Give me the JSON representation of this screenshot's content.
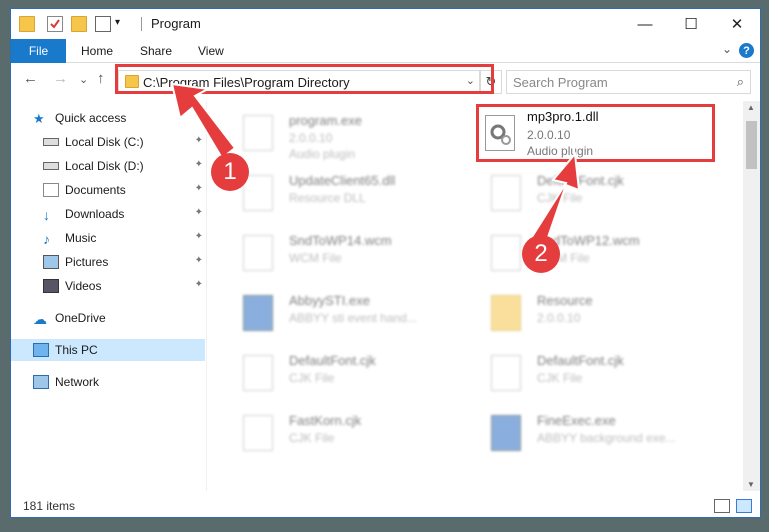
{
  "window": {
    "title": "Program",
    "minimize": "—",
    "maximize": "☐",
    "close": "✕"
  },
  "ribbon": {
    "tabs": [
      "File",
      "Home",
      "Share",
      "View"
    ],
    "help": "?",
    "collapse": "⌄"
  },
  "nav": {
    "back": "←",
    "forward": "→",
    "recent": "⌄",
    "up": "↑",
    "address": "C:\\Program Files\\Program Directory",
    "dropdown": "⌄",
    "refresh": "↻",
    "search_placeholder": "Search Program",
    "search_icon": "⌕"
  },
  "sidebar": {
    "items": [
      {
        "label": "Quick access",
        "icon": "star-icon",
        "pinned": false
      },
      {
        "label": "Local Disk (C:)",
        "icon": "drive-icon",
        "pinned": true
      },
      {
        "label": "Local Disk (D:)",
        "icon": "drive-icon",
        "pinned": true
      },
      {
        "label": "Documents",
        "icon": "documents-icon",
        "pinned": true
      },
      {
        "label": "Downloads",
        "icon": "downloads-icon",
        "pinned": true
      },
      {
        "label": "Music",
        "icon": "music-icon",
        "pinned": true
      },
      {
        "label": "Pictures",
        "icon": "pictures-icon",
        "pinned": true
      },
      {
        "label": "Videos",
        "icon": "videos-icon",
        "pinned": true
      },
      {
        "label": "OneDrive",
        "icon": "cloud-icon",
        "pinned": false
      },
      {
        "label": "This PC",
        "icon": "computer-icon",
        "pinned": false
      },
      {
        "label": "Network",
        "icon": "network-icon",
        "pinned": false
      }
    ],
    "pin_glyph": "📌"
  },
  "files": [
    {
      "name": "program.exe",
      "sub": "2.0.0.10",
      "type": "Audio plugin"
    },
    {
      "name": "UpdateClient65.dll",
      "sub": "Resource DLL",
      "type": ""
    },
    {
      "name": "DefaultFont.cjk",
      "sub": "CJK File",
      "type": ""
    },
    {
      "name": "SndToWP14.wcm",
      "sub": "WCM File",
      "type": ""
    },
    {
      "name": "SndToWP12.wcm",
      "sub": "WCM File",
      "type": ""
    },
    {
      "name": "AbbyySTI.exe",
      "sub": "ABBYY sti event hand...",
      "type": ""
    },
    {
      "name": "Resource",
      "sub": "2.0.0.10",
      "type": ""
    },
    {
      "name": "DefaultFont.cjk",
      "sub": "CJK File",
      "type": ""
    },
    {
      "name": "DefaultFont.cjk",
      "sub": "CJK File",
      "type": ""
    },
    {
      "name": "FastKorn.cjk",
      "sub": "CJK File",
      "type": ""
    },
    {
      "name": "FineExec.exe",
      "sub": "ABBYY background exe...",
      "type": ""
    }
  ],
  "focus_file": {
    "name": "mp3pro.1.dll",
    "version": "2.0.0.10",
    "type": "Audio plugin"
  },
  "status": {
    "count": "181 items"
  },
  "annotations": {
    "step1": "1",
    "step2": "2",
    "color": "#e53d3d"
  }
}
